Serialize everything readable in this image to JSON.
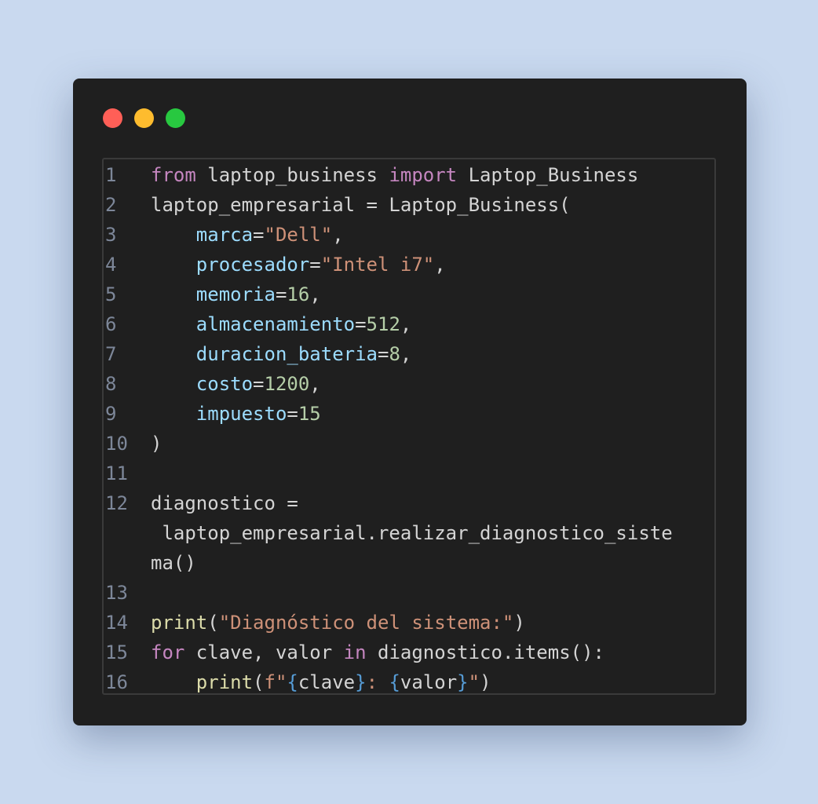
{
  "window": {
    "controls": [
      "close",
      "minimize",
      "maximize"
    ],
    "colors": {
      "close": "#ff5f57",
      "minimize": "#febc2e",
      "maximize": "#28c840"
    }
  },
  "editor": {
    "language": "python",
    "lines": [
      {
        "n": "1",
        "tokens": [
          {
            "t": "from",
            "c": "kw"
          },
          {
            "t": " laptop_business "
          },
          {
            "t": "import",
            "c": "kw"
          },
          {
            "t": " Laptop_Business"
          }
        ]
      },
      {
        "n": "2",
        "tokens": [
          {
            "t": "laptop_empresarial = Laptop_Business("
          }
        ]
      },
      {
        "n": "3",
        "tokens": [
          {
            "t": "    "
          },
          {
            "t": "marca",
            "c": "pm"
          },
          {
            "t": "="
          },
          {
            "t": "\"Dell\"",
            "c": "st"
          },
          {
            "t": ","
          }
        ]
      },
      {
        "n": "4",
        "tokens": [
          {
            "t": "    "
          },
          {
            "t": "procesador",
            "c": "pm"
          },
          {
            "t": "="
          },
          {
            "t": "\"Intel i7\"",
            "c": "st"
          },
          {
            "t": ","
          }
        ]
      },
      {
        "n": "5",
        "tokens": [
          {
            "t": "    "
          },
          {
            "t": "memoria",
            "c": "pm"
          },
          {
            "t": "="
          },
          {
            "t": "16",
            "c": "nm"
          },
          {
            "t": ","
          }
        ]
      },
      {
        "n": "6",
        "tokens": [
          {
            "t": "    "
          },
          {
            "t": "almacenamiento",
            "c": "pm"
          },
          {
            "t": "="
          },
          {
            "t": "512",
            "c": "nm"
          },
          {
            "t": ","
          }
        ]
      },
      {
        "n": "7",
        "tokens": [
          {
            "t": "    "
          },
          {
            "t": "duracion_bateria",
            "c": "pm"
          },
          {
            "t": "="
          },
          {
            "t": "8",
            "c": "nm"
          },
          {
            "t": ","
          }
        ]
      },
      {
        "n": "8",
        "tokens": [
          {
            "t": "    "
          },
          {
            "t": "costo",
            "c": "pm"
          },
          {
            "t": "="
          },
          {
            "t": "1200",
            "c": "nm"
          },
          {
            "t": ","
          }
        ]
      },
      {
        "n": "9",
        "tokens": [
          {
            "t": "    "
          },
          {
            "t": "impuesto",
            "c": "pm"
          },
          {
            "t": "="
          },
          {
            "t": "15",
            "c": "nm"
          }
        ]
      },
      {
        "n": "10",
        "tokens": [
          {
            "t": ")"
          }
        ]
      },
      {
        "n": "11",
        "tokens": []
      },
      {
        "n": "12",
        "tokens": [
          {
            "t": "diagnostico ="
          }
        ]
      },
      {
        "n": "",
        "tokens": [
          {
            "t": " laptop_empresarial.realizar_diagnostico_siste"
          }
        ]
      },
      {
        "n": "",
        "tokens": [
          {
            "t": "ma()"
          }
        ]
      },
      {
        "n": "13",
        "tokens": []
      },
      {
        "n": "14",
        "tokens": [
          {
            "t": "print",
            "c": "fn"
          },
          {
            "t": "("
          },
          {
            "t": "\"Diagnóstico del sistema:\"",
            "c": "st"
          },
          {
            "t": ")"
          }
        ]
      },
      {
        "n": "15",
        "tokens": [
          {
            "t": "for",
            "c": "kw"
          },
          {
            "t": " clave, valor "
          },
          {
            "t": "in",
            "c": "kw"
          },
          {
            "t": " diagnostico.items():"
          }
        ]
      },
      {
        "n": "16",
        "tokens": [
          {
            "t": "    "
          },
          {
            "t": "print",
            "c": "fn"
          },
          {
            "t": "("
          },
          {
            "t": "f\"",
            "c": "st"
          },
          {
            "t": "{",
            "c": "br"
          },
          {
            "t": "clave"
          },
          {
            "t": "}",
            "c": "br"
          },
          {
            "t": ": ",
            "c": "st"
          },
          {
            "t": "{",
            "c": "br"
          },
          {
            "t": "valor"
          },
          {
            "t": "}",
            "c": "br"
          },
          {
            "t": "\"",
            "c": "st"
          },
          {
            "t": ")"
          }
        ]
      }
    ]
  }
}
